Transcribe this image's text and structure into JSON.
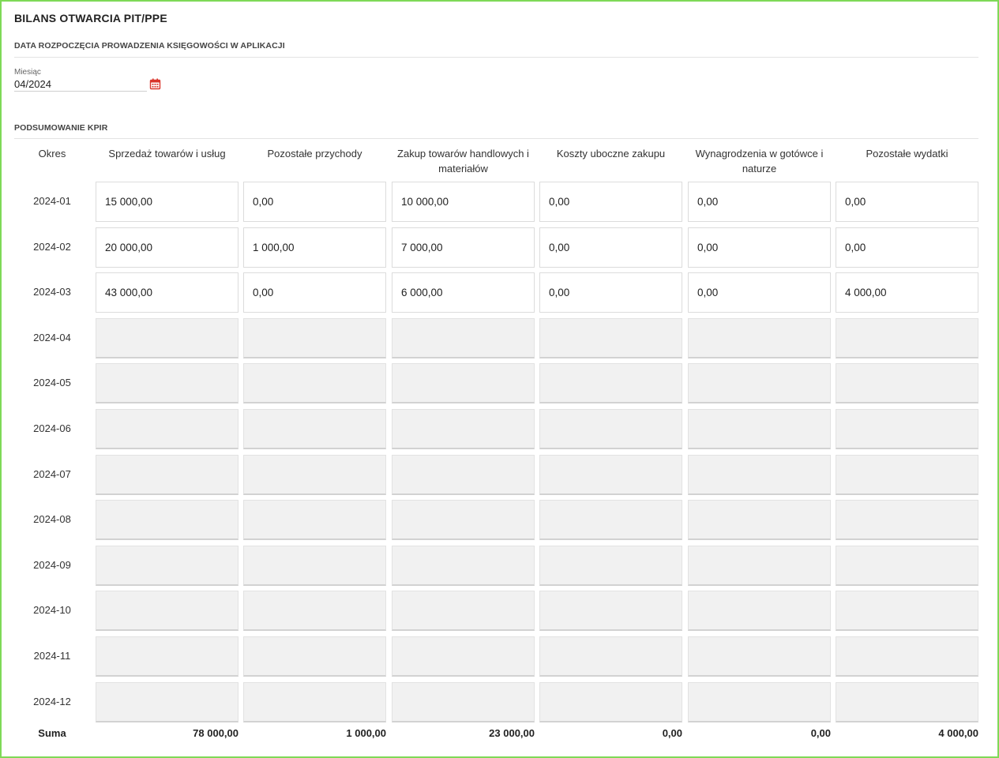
{
  "title": "BILANS OTWARCIA PIT/PPE",
  "start_section": {
    "label": "DATA ROZPOCZĘCIA PROWADZENIA KSIĘGOWOŚCI W APLIKACJI",
    "month_label": "Miesiąc",
    "month_value": "04/2024",
    "calendar_icon": "calendar-icon"
  },
  "summary_section": {
    "label": "PODSUMOWANIE KPIR"
  },
  "table": {
    "headers": [
      "Okres",
      "Sprzedaż towarów i usług",
      "Pozostałe przychody",
      "Zakup towarów handlowych i materiałów",
      "Koszty uboczne zakupu",
      "Wynagrodzenia w gotówce i naturze",
      "Pozostałe wydatki"
    ],
    "rows": [
      {
        "period": "2024-01",
        "values": [
          "15 000,00",
          "0,00",
          "10 000,00",
          "0,00",
          "0,00",
          "0,00"
        ]
      },
      {
        "period": "2024-02",
        "values": [
          "20 000,00",
          "1 000,00",
          "7 000,00",
          "0,00",
          "0,00",
          "0,00"
        ]
      },
      {
        "period": "2024-03",
        "values": [
          "43 000,00",
          "0,00",
          "6 000,00",
          "0,00",
          "0,00",
          "4 000,00"
        ]
      },
      {
        "period": "2024-04",
        "values": [
          "",
          "",
          "",
          "",
          "",
          ""
        ]
      },
      {
        "period": "2024-05",
        "values": [
          "",
          "",
          "",
          "",
          "",
          ""
        ]
      },
      {
        "period": "2024-06",
        "values": [
          "",
          "",
          "",
          "",
          "",
          ""
        ]
      },
      {
        "period": "2024-07",
        "values": [
          "",
          "",
          "",
          "",
          "",
          ""
        ]
      },
      {
        "period": "2024-08",
        "values": [
          "",
          "",
          "",
          "",
          "",
          ""
        ]
      },
      {
        "period": "2024-09",
        "values": [
          "",
          "",
          "",
          "",
          "",
          ""
        ]
      },
      {
        "period": "2024-10",
        "values": [
          "",
          "",
          "",
          "",
          "",
          ""
        ]
      },
      {
        "period": "2024-11",
        "values": [
          "",
          "",
          "",
          "",
          "",
          ""
        ]
      },
      {
        "period": "2024-12",
        "values": [
          "",
          "",
          "",
          "",
          "",
          ""
        ]
      }
    ],
    "sum_label": "Suma",
    "sums": [
      "78 000,00",
      "1 000,00",
      "23 000,00",
      "0,00",
      "0,00",
      "4 000,00"
    ]
  },
  "colors": {
    "frame_border": "#7ed957",
    "calendar_icon": "#d9342b",
    "empty_cell_bg": "#f1f1f1"
  }
}
